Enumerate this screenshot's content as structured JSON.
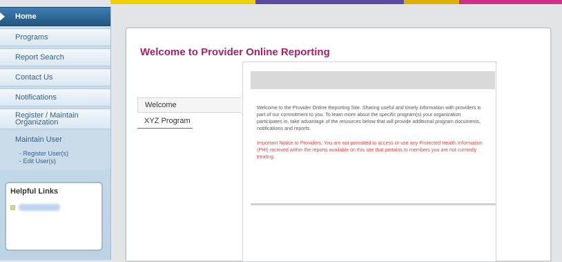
{
  "colors": {
    "title": "#a5206b",
    "nav_active": "#2d6596",
    "notice": "#e4413d",
    "stripe": [
      "#f0d000",
      "#5a4aa0",
      "#e0b000",
      "#d0308a"
    ]
  },
  "sidebar": {
    "items": [
      {
        "label": "Home",
        "active": true
      },
      {
        "label": "Programs"
      },
      {
        "label": "Report Search"
      },
      {
        "label": "Contact Us"
      },
      {
        "label": "Notifications"
      },
      {
        "label_line1": "Register / Maintain",
        "label_line2": "Organization"
      }
    ],
    "maintain_user": {
      "label": "Maintain User",
      "sublinks": [
        "- Register User(s)",
        "- Edit User(s)"
      ]
    },
    "helpful_links": {
      "title": "Helpful Links"
    }
  },
  "main": {
    "title": "Welcome to Provider Online Reporting",
    "tabs": [
      "Welcome",
      "XYZ Program"
    ],
    "welcome_text": "Welcome to the Provider Online Reporting Site. Sharing useful and timely information with providers is part of our commitment to you. To learn more about the specific program(s) your organization participates in, take advantage of the resources below that will provide additional program documents, notifications and reports.",
    "notice_text": "Important Notice to Providers: You are not permitted to access or use any Protected Health Information (PHI) received within the reports available on this site that pertains to members you are not currently treating."
  }
}
